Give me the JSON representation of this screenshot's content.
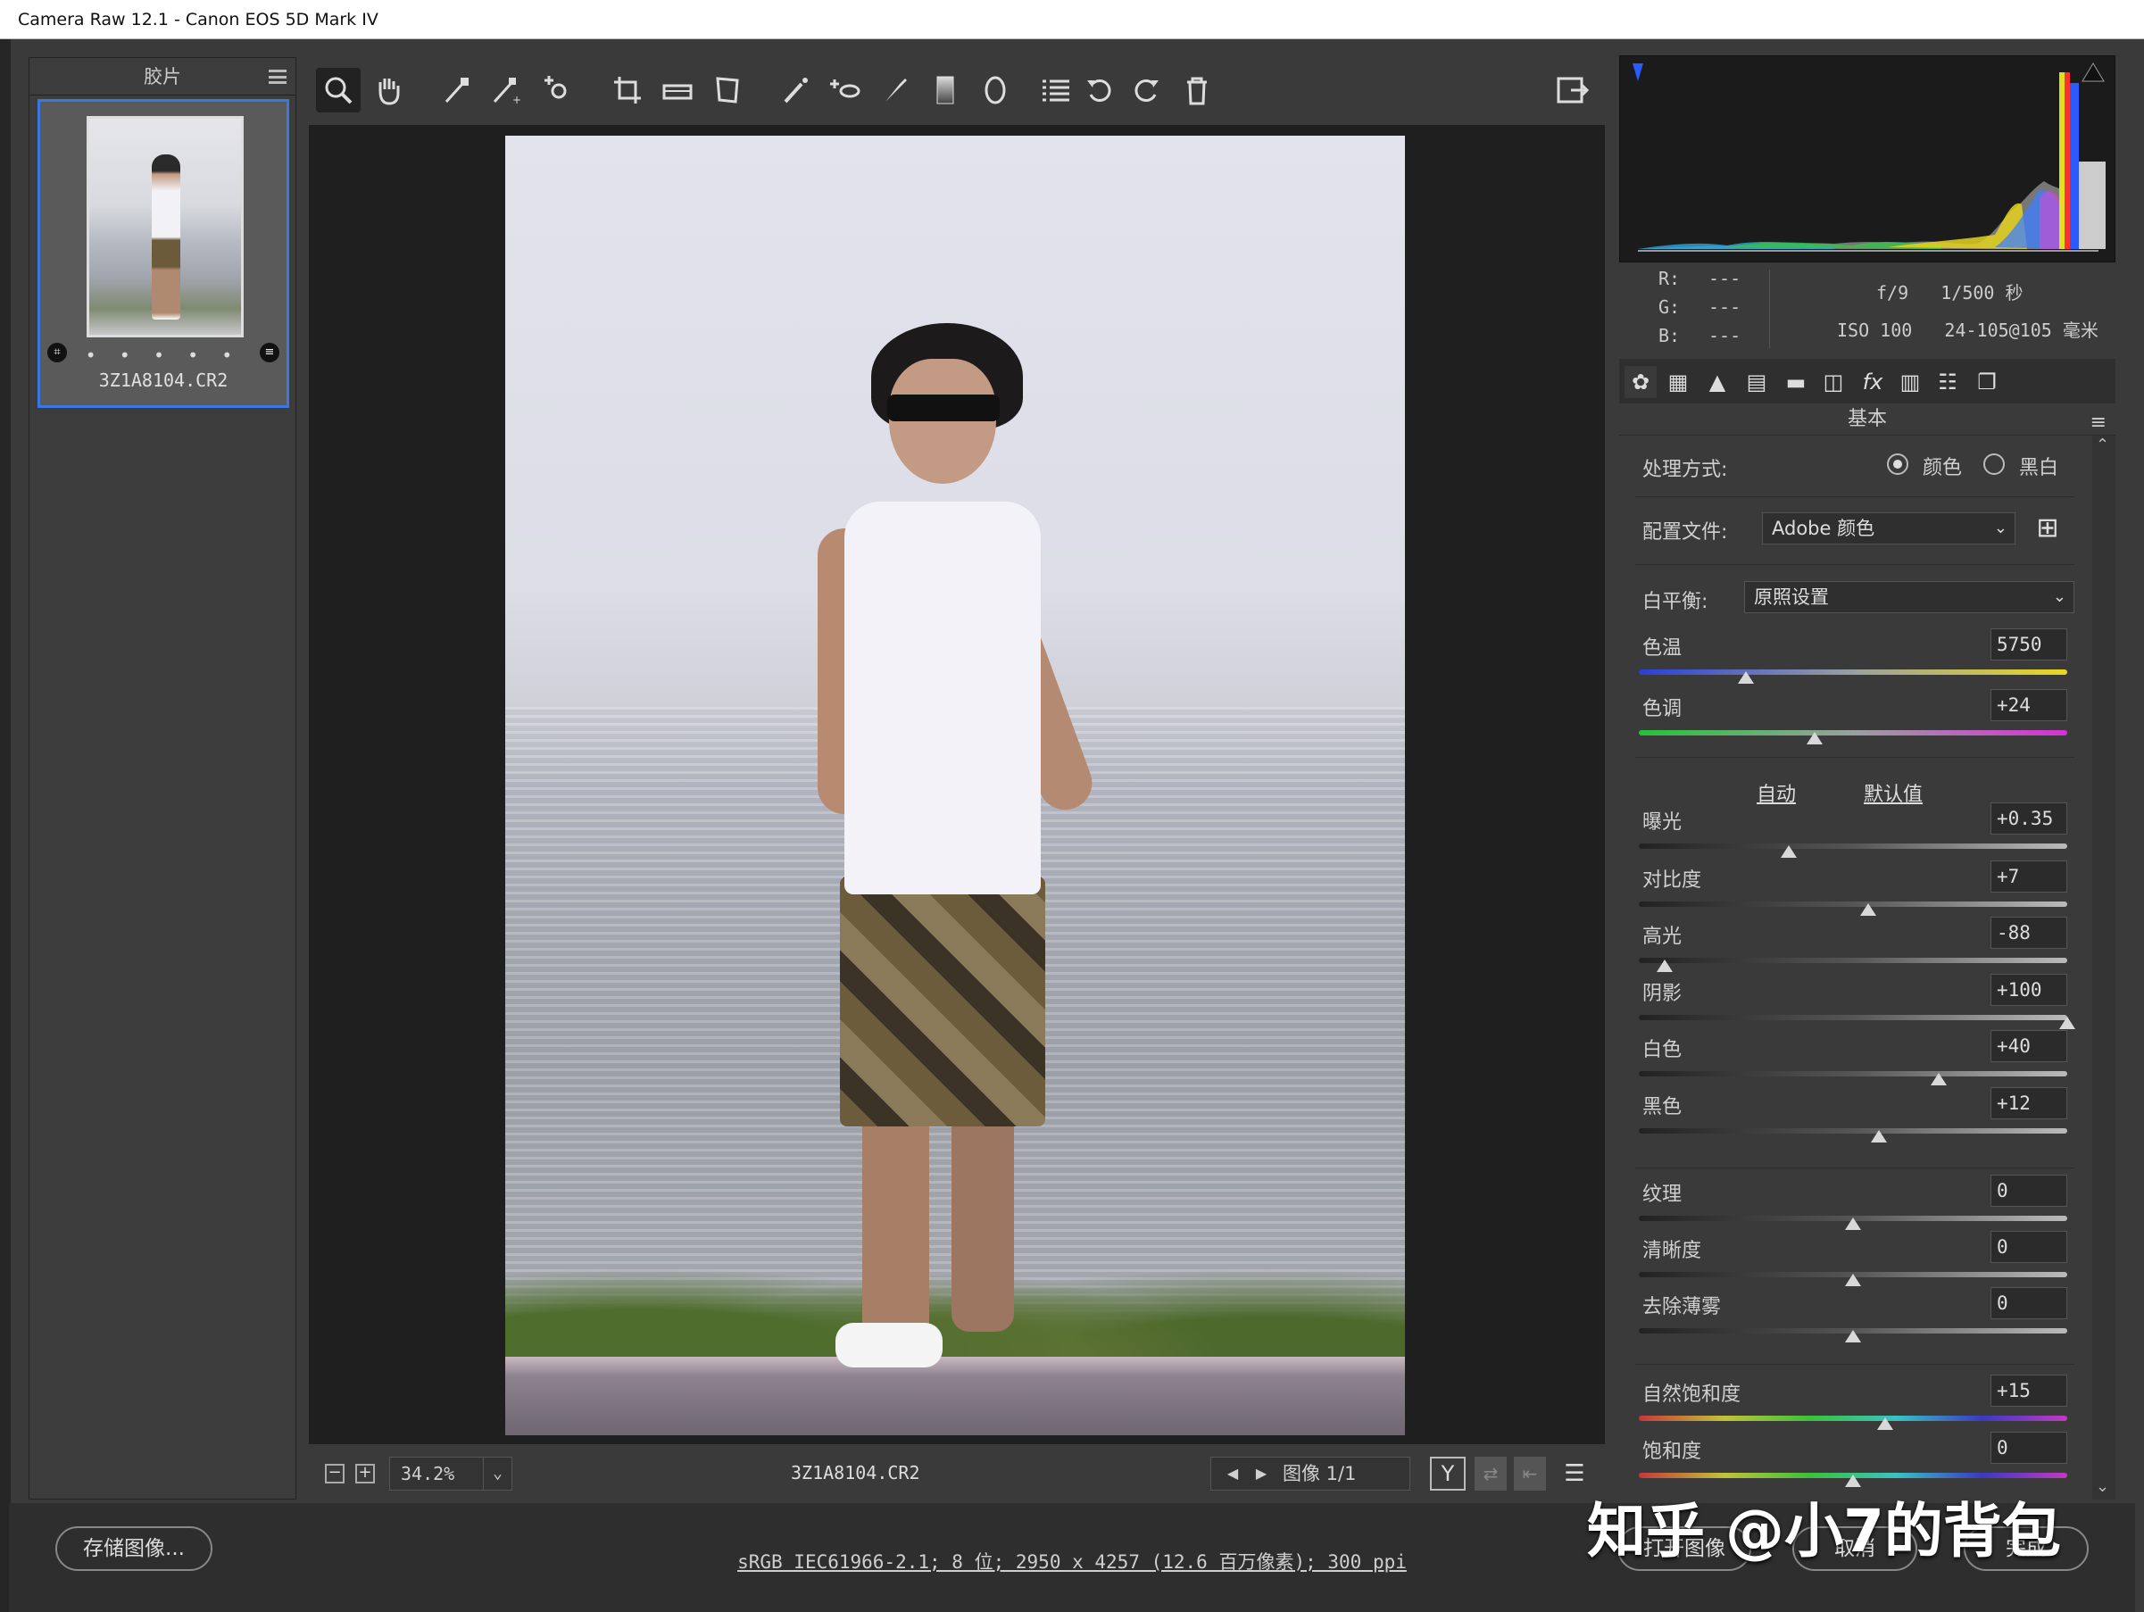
{
  "window": {
    "title": "Camera Raw 12.1 -  Canon EOS 5D Mark IV"
  },
  "filmstrip": {
    "title": "胶片",
    "filename": "3Z1A8104.CR2",
    "dots": "• • • • •"
  },
  "toolbar": {
    "tools": [
      "zoom-icon",
      "hand-icon",
      "white-balance-icon",
      "color-sampler-icon",
      "target-adjust-icon",
      "crop-icon",
      "straighten-icon",
      "transform-icon",
      "spot-removal-icon",
      "red-eye-icon",
      "adjustment-brush-icon",
      "graduated-filter-icon",
      "radial-filter-icon",
      "preferences-icon",
      "rotate-ccw-icon",
      "rotate-cw-icon",
      "trash-icon"
    ]
  },
  "preview": {
    "zoom": "34.2%",
    "filename": "3Z1A8104.CR2",
    "image_nav": "图像 1/1"
  },
  "info": {
    "r_label": "R:",
    "g_label": "G:",
    "b_label": "B:",
    "r": "---",
    "g": "---",
    "b": "---",
    "aperture_shutter": "f/9   1/500 秒",
    "iso_lens": "ISO 100   24-105@105 毫米"
  },
  "panel": {
    "title": "基本",
    "treatment_label": "处理方式:",
    "treatment_color": "颜色",
    "treatment_bw": "黑白",
    "profile_label": "配置文件:",
    "profile_value": "Adobe 颜色",
    "wb_label": "白平衡:",
    "wb_value": "原照设置",
    "auto": "自动",
    "default": "默认值",
    "sliders": [
      {
        "label": "色温",
        "value": "5750",
        "pos": 0.25
      },
      {
        "label": "色调",
        "value": "+24",
        "pos": 0.41
      },
      {
        "label": "曝光",
        "value": "+0.35",
        "pos": 0.35
      },
      {
        "label": "对比度",
        "value": "+7",
        "pos": 0.535
      },
      {
        "label": "高光",
        "value": "-88",
        "pos": 0.06
      },
      {
        "label": "阴影",
        "value": "+100",
        "pos": 1.0
      },
      {
        "label": "白色",
        "value": "+40",
        "pos": 0.7
      },
      {
        "label": "黑色",
        "value": "+12",
        "pos": 0.56
      },
      {
        "label": "纹理",
        "value": "0",
        "pos": 0.5
      },
      {
        "label": "清晰度",
        "value": "0",
        "pos": 0.5
      },
      {
        "label": "去除薄雾",
        "value": "0",
        "pos": 0.5
      },
      {
        "label": "自然饱和度",
        "value": "+15",
        "pos": 0.575
      },
      {
        "label": "饱和度",
        "value": "0",
        "pos": 0.5
      }
    ]
  },
  "footer": {
    "save": "存储图像...",
    "workflow": "sRGB IEC61966-2.1; 8 位;  2950 x 4257 (12.6 百万像素); 300 ppi",
    "open": "打开图像",
    "cancel": "取消",
    "done": "完成"
  },
  "watermark": "知乎 @小7的背包"
}
